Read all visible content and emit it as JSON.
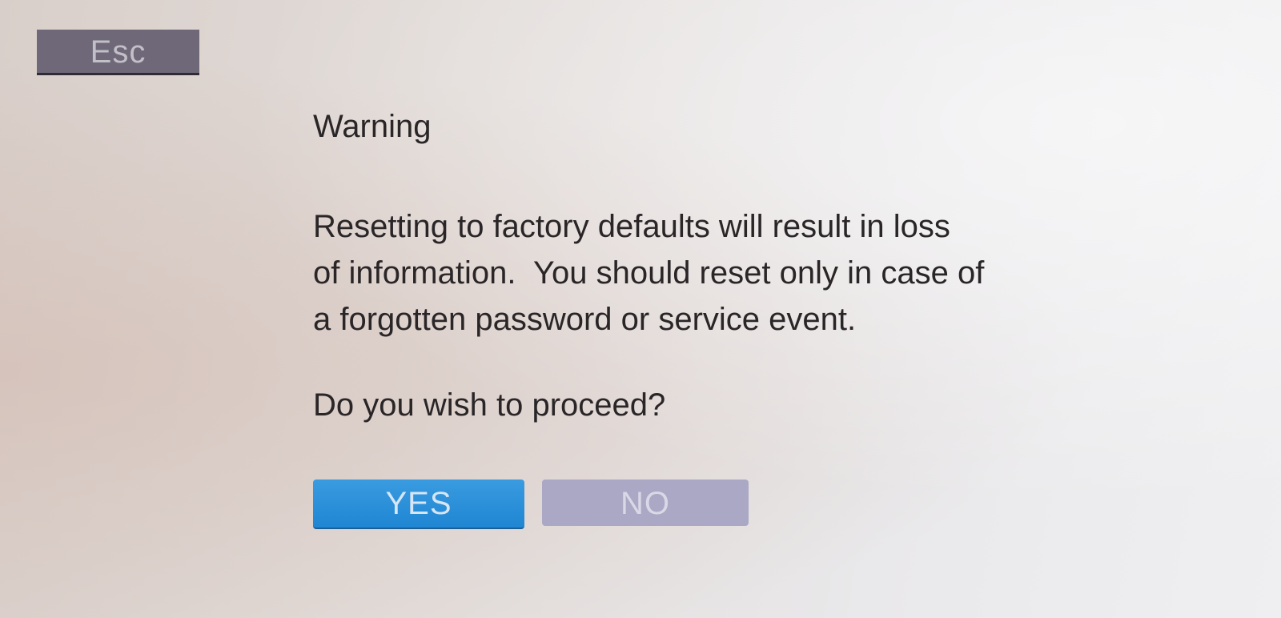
{
  "toolbar": {
    "esc_label": "Esc"
  },
  "dialog": {
    "title": "Warning",
    "message_lines": [
      "Resetting to factory defaults will result in loss",
      "of information.  You should reset only in case of",
      "a forgotten password or service event."
    ],
    "question": "Do you wish to proceed?",
    "yes_label": "YES",
    "no_label": "NO"
  },
  "colors": {
    "yes_button": "#1f86d3",
    "no_button": "#aaa8c4",
    "esc_button": "#6e6879"
  }
}
